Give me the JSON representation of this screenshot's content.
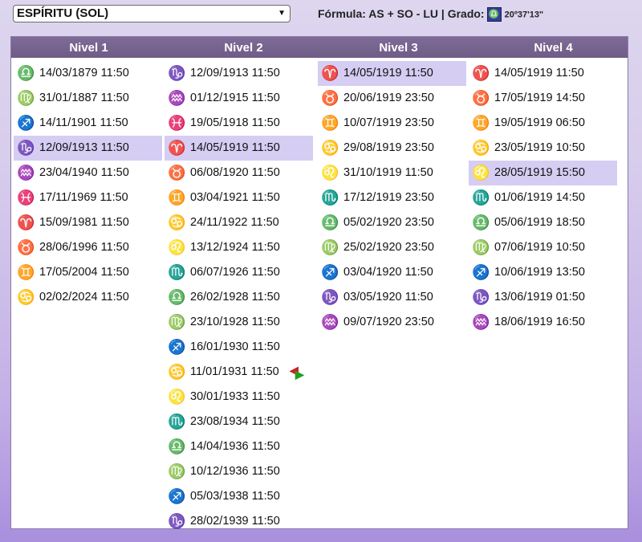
{
  "selector": {
    "value": "ESPÍRITU (SOL)",
    "arrow_icon": "caret-down-icon"
  },
  "formula": {
    "label": "Fórmula: AS + SO - LU | Grado:",
    "grado_badge": "♎",
    "grado_value": "20º37'13\""
  },
  "colors": {
    "header_bg": "#76638f",
    "selected_row": "#d6cdf3",
    "air": "#2e8ad8",
    "fire": "#e86a1c",
    "earth": "#7a3a1a",
    "water": "#2a3a6a",
    "purple": "#6a3a9a"
  },
  "columns": [
    {
      "title": "Nivel 1",
      "rows": [
        {
          "sign": "libra",
          "glyph": "♎",
          "color": "#2e8ad8",
          "date": "14/03/1879 11:50"
        },
        {
          "sign": "virgo",
          "glyph": "♍",
          "color": "#e0901c",
          "date": "31/01/1887 11:50"
        },
        {
          "sign": "sagittarius",
          "glyph": "♐",
          "color": "#e05a1c",
          "date": "14/11/1901 11:50"
        },
        {
          "sign": "capricorn",
          "glyph": "♑",
          "color": "#7a3a1a",
          "date": "12/09/1913 11:50",
          "selected": true
        },
        {
          "sign": "aquarius",
          "glyph": "♒",
          "color": "#6a3a9a",
          "date": "23/04/1940 11:50"
        },
        {
          "sign": "pisces",
          "glyph": "♓",
          "color": "#2e8ad8",
          "date": "17/11/1969 11:50"
        },
        {
          "sign": "aries",
          "glyph": "♈",
          "color": "#5a2a0a",
          "date": "15/09/1981 11:50"
        },
        {
          "sign": "taurus",
          "glyph": "♉",
          "color": "#7a4a1a",
          "date": "28/06/1996 11:50"
        },
        {
          "sign": "gemini",
          "glyph": "♊",
          "color": "#2e6ad8",
          "date": "17/05/2004 11:50"
        },
        {
          "sign": "cancer",
          "glyph": "♋",
          "color": "#2a3a6a",
          "date": "02/02/2024 11:50"
        }
      ]
    },
    {
      "title": "Nivel 2",
      "rows": [
        {
          "sign": "capricorn",
          "glyph": "♑",
          "color": "#7a3a1a",
          "date": "12/09/1913 11:50"
        },
        {
          "sign": "aquarius",
          "glyph": "♒",
          "color": "#6a3a9a",
          "date": "01/12/1915 11:50"
        },
        {
          "sign": "pisces",
          "glyph": "♓",
          "color": "#2e8ad8",
          "date": "19/05/1918 11:50"
        },
        {
          "sign": "aries",
          "glyph": "♈",
          "color": "#5a2a0a",
          "date": "14/05/1919 11:50",
          "selected": true
        },
        {
          "sign": "taurus",
          "glyph": "♉",
          "color": "#7a4a1a",
          "date": "06/08/1920 11:50"
        },
        {
          "sign": "gemini",
          "glyph": "♊",
          "color": "#2e6ad8",
          "date": "03/04/1921 11:50"
        },
        {
          "sign": "cancer",
          "glyph": "♋",
          "color": "#2a3a6a",
          "date": "24/11/1922 11:50"
        },
        {
          "sign": "leo",
          "glyph": "♌",
          "color": "#d04a10",
          "date": "13/12/1924 11:50"
        },
        {
          "sign": "scorpio",
          "glyph": "♏",
          "color": "#3a2a8a",
          "date": "06/07/1926 11:50"
        },
        {
          "sign": "libra",
          "glyph": "♎",
          "color": "#2e8ad8",
          "date": "26/02/1928 11:50"
        },
        {
          "sign": "virgo",
          "glyph": "♍",
          "color": "#e0901c",
          "date": "23/10/1928 11:50"
        },
        {
          "sign": "sagittarius",
          "glyph": "♐",
          "color": "#e05a1c",
          "date": "16/01/1930 11:50"
        },
        {
          "sign": "cancer",
          "glyph": "♋",
          "color": "#2a3a6a",
          "date": "11/01/1931 11:50",
          "arrows": true
        },
        {
          "sign": "leo",
          "glyph": "♌",
          "color": "#d04a10",
          "date": "30/01/1933 11:50"
        },
        {
          "sign": "scorpio",
          "glyph": "♏",
          "color": "#3a2a8a",
          "date": "23/08/1934 11:50"
        },
        {
          "sign": "libra",
          "glyph": "♎",
          "color": "#2e8ad8",
          "date": "14/04/1936 11:50"
        },
        {
          "sign": "virgo",
          "glyph": "♍",
          "color": "#e0901c",
          "date": "10/12/1936 11:50"
        },
        {
          "sign": "sagittarius",
          "glyph": "♐",
          "color": "#e05a1c",
          "date": "05/03/1938 11:50"
        },
        {
          "sign": "capricorn",
          "glyph": "♑",
          "color": "#7a3a1a",
          "date": "28/02/1939 11:50"
        }
      ]
    },
    {
      "title": "Nivel 3",
      "rows": [
        {
          "sign": "aries",
          "glyph": "♈",
          "color": "#5a2a0a",
          "date": "14/05/1919 11:50",
          "selected": true
        },
        {
          "sign": "taurus",
          "glyph": "♉",
          "color": "#7a4a1a",
          "date": "20/06/1919 23:50"
        },
        {
          "sign": "gemini",
          "glyph": "♊",
          "color": "#2e6ad8",
          "date": "10/07/1919 23:50"
        },
        {
          "sign": "cancer",
          "glyph": "♋",
          "color": "#2a3a6a",
          "date": "29/08/1919 23:50"
        },
        {
          "sign": "leo",
          "glyph": "♌",
          "color": "#d04a10",
          "date": "31/10/1919 11:50"
        },
        {
          "sign": "scorpio",
          "glyph": "♏",
          "color": "#3a2a8a",
          "date": "17/12/1919 23:50"
        },
        {
          "sign": "libra",
          "glyph": "♎",
          "color": "#2e8ad8",
          "date": "05/02/1920 23:50"
        },
        {
          "sign": "virgo",
          "glyph": "♍",
          "color": "#e0901c",
          "date": "25/02/1920 23:50"
        },
        {
          "sign": "sagittarius",
          "glyph": "♐",
          "color": "#e05a1c",
          "date": "03/04/1920 11:50"
        },
        {
          "sign": "capricorn",
          "glyph": "♑",
          "color": "#7a3a1a",
          "date": "03/05/1920 11:50"
        },
        {
          "sign": "aquarius",
          "glyph": "♒",
          "color": "#6a3a9a",
          "date": "09/07/1920 23:50"
        }
      ]
    },
    {
      "title": "Nivel 4",
      "rows": [
        {
          "sign": "aries",
          "glyph": "♈",
          "color": "#5a2a0a",
          "date": "14/05/1919 11:50"
        },
        {
          "sign": "taurus",
          "glyph": "♉",
          "color": "#7a4a1a",
          "date": "17/05/1919 14:50"
        },
        {
          "sign": "gemini",
          "glyph": "♊",
          "color": "#2e6ad8",
          "date": "19/05/1919 06:50"
        },
        {
          "sign": "cancer",
          "glyph": "♋",
          "color": "#2a3a6a",
          "date": "23/05/1919 10:50"
        },
        {
          "sign": "leo",
          "glyph": "♌",
          "color": "#d04a10",
          "date": "28/05/1919 15:50",
          "selected": true
        },
        {
          "sign": "scorpio",
          "glyph": "♏",
          "color": "#3a2a8a",
          "date": "01/06/1919 14:50"
        },
        {
          "sign": "libra",
          "glyph": "♎",
          "color": "#2e8ad8",
          "date": "05/06/1919 18:50"
        },
        {
          "sign": "virgo",
          "glyph": "♍",
          "color": "#e0901c",
          "date": "07/06/1919 10:50"
        },
        {
          "sign": "sagittarius",
          "glyph": "♐",
          "color": "#e05a1c",
          "date": "10/06/1919 13:50"
        },
        {
          "sign": "capricorn",
          "glyph": "♑",
          "color": "#7a3a1a",
          "date": "13/06/1919 01:50"
        },
        {
          "sign": "aquarius",
          "glyph": "♒",
          "color": "#6a3a9a",
          "date": "18/06/1919 16:50"
        }
      ]
    }
  ]
}
